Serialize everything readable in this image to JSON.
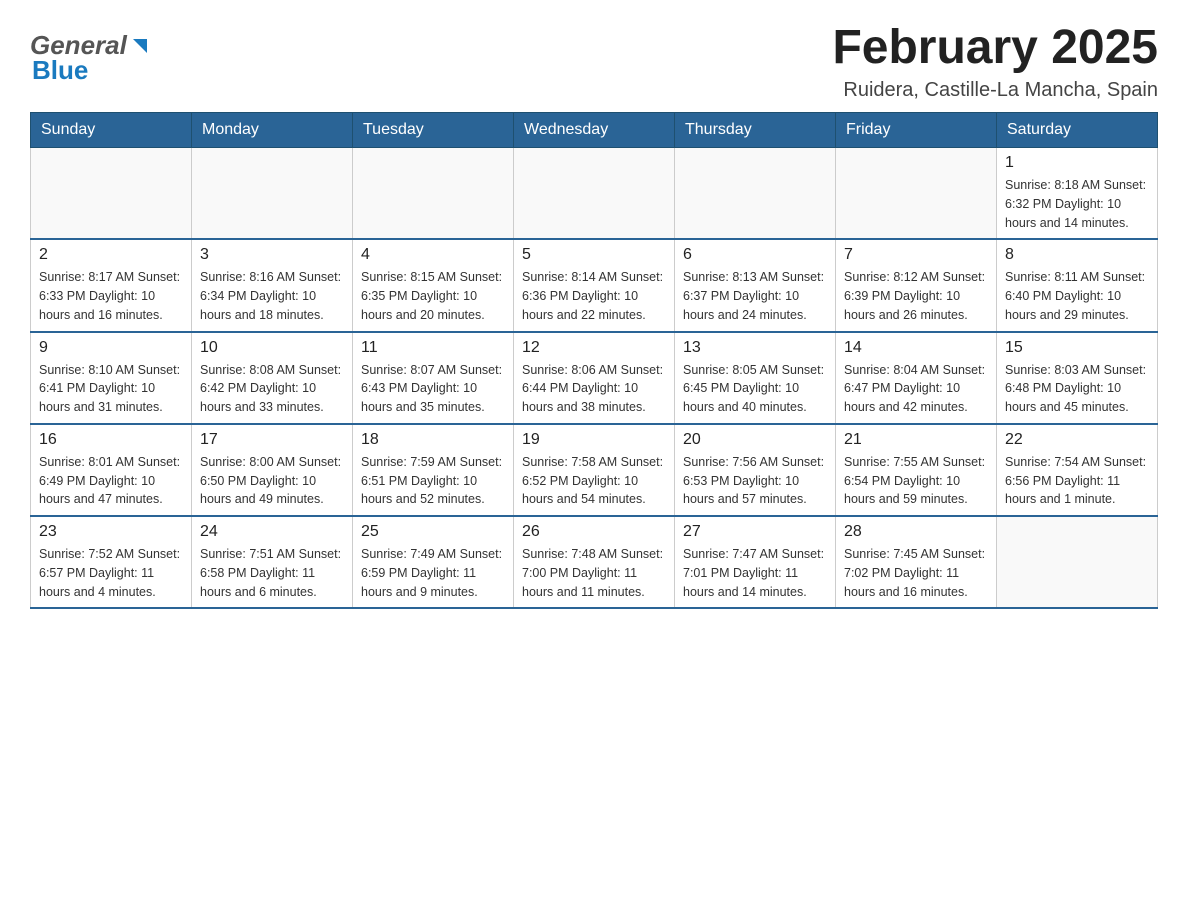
{
  "header": {
    "logo_general": "General",
    "logo_blue": "Blue",
    "title": "February 2025",
    "subtitle": "Ruidera, Castille-La Mancha, Spain"
  },
  "calendar": {
    "days_of_week": [
      "Sunday",
      "Monday",
      "Tuesday",
      "Wednesday",
      "Thursday",
      "Friday",
      "Saturday"
    ],
    "weeks": [
      [
        {
          "day": "",
          "info": ""
        },
        {
          "day": "",
          "info": ""
        },
        {
          "day": "",
          "info": ""
        },
        {
          "day": "",
          "info": ""
        },
        {
          "day": "",
          "info": ""
        },
        {
          "day": "",
          "info": ""
        },
        {
          "day": "1",
          "info": "Sunrise: 8:18 AM\nSunset: 6:32 PM\nDaylight: 10 hours and 14 minutes."
        }
      ],
      [
        {
          "day": "2",
          "info": "Sunrise: 8:17 AM\nSunset: 6:33 PM\nDaylight: 10 hours and 16 minutes."
        },
        {
          "day": "3",
          "info": "Sunrise: 8:16 AM\nSunset: 6:34 PM\nDaylight: 10 hours and 18 minutes."
        },
        {
          "day": "4",
          "info": "Sunrise: 8:15 AM\nSunset: 6:35 PM\nDaylight: 10 hours and 20 minutes."
        },
        {
          "day": "5",
          "info": "Sunrise: 8:14 AM\nSunset: 6:36 PM\nDaylight: 10 hours and 22 minutes."
        },
        {
          "day": "6",
          "info": "Sunrise: 8:13 AM\nSunset: 6:37 PM\nDaylight: 10 hours and 24 minutes."
        },
        {
          "day": "7",
          "info": "Sunrise: 8:12 AM\nSunset: 6:39 PM\nDaylight: 10 hours and 26 minutes."
        },
        {
          "day": "8",
          "info": "Sunrise: 8:11 AM\nSunset: 6:40 PM\nDaylight: 10 hours and 29 minutes."
        }
      ],
      [
        {
          "day": "9",
          "info": "Sunrise: 8:10 AM\nSunset: 6:41 PM\nDaylight: 10 hours and 31 minutes."
        },
        {
          "day": "10",
          "info": "Sunrise: 8:08 AM\nSunset: 6:42 PM\nDaylight: 10 hours and 33 minutes."
        },
        {
          "day": "11",
          "info": "Sunrise: 8:07 AM\nSunset: 6:43 PM\nDaylight: 10 hours and 35 minutes."
        },
        {
          "day": "12",
          "info": "Sunrise: 8:06 AM\nSunset: 6:44 PM\nDaylight: 10 hours and 38 minutes."
        },
        {
          "day": "13",
          "info": "Sunrise: 8:05 AM\nSunset: 6:45 PM\nDaylight: 10 hours and 40 minutes."
        },
        {
          "day": "14",
          "info": "Sunrise: 8:04 AM\nSunset: 6:47 PM\nDaylight: 10 hours and 42 minutes."
        },
        {
          "day": "15",
          "info": "Sunrise: 8:03 AM\nSunset: 6:48 PM\nDaylight: 10 hours and 45 minutes."
        }
      ],
      [
        {
          "day": "16",
          "info": "Sunrise: 8:01 AM\nSunset: 6:49 PM\nDaylight: 10 hours and 47 minutes."
        },
        {
          "day": "17",
          "info": "Sunrise: 8:00 AM\nSunset: 6:50 PM\nDaylight: 10 hours and 49 minutes."
        },
        {
          "day": "18",
          "info": "Sunrise: 7:59 AM\nSunset: 6:51 PM\nDaylight: 10 hours and 52 minutes."
        },
        {
          "day": "19",
          "info": "Sunrise: 7:58 AM\nSunset: 6:52 PM\nDaylight: 10 hours and 54 minutes."
        },
        {
          "day": "20",
          "info": "Sunrise: 7:56 AM\nSunset: 6:53 PM\nDaylight: 10 hours and 57 minutes."
        },
        {
          "day": "21",
          "info": "Sunrise: 7:55 AM\nSunset: 6:54 PM\nDaylight: 10 hours and 59 minutes."
        },
        {
          "day": "22",
          "info": "Sunrise: 7:54 AM\nSunset: 6:56 PM\nDaylight: 11 hours and 1 minute."
        }
      ],
      [
        {
          "day": "23",
          "info": "Sunrise: 7:52 AM\nSunset: 6:57 PM\nDaylight: 11 hours and 4 minutes."
        },
        {
          "day": "24",
          "info": "Sunrise: 7:51 AM\nSunset: 6:58 PM\nDaylight: 11 hours and 6 minutes."
        },
        {
          "day": "25",
          "info": "Sunrise: 7:49 AM\nSunset: 6:59 PM\nDaylight: 11 hours and 9 minutes."
        },
        {
          "day": "26",
          "info": "Sunrise: 7:48 AM\nSunset: 7:00 PM\nDaylight: 11 hours and 11 minutes."
        },
        {
          "day": "27",
          "info": "Sunrise: 7:47 AM\nSunset: 7:01 PM\nDaylight: 11 hours and 14 minutes."
        },
        {
          "day": "28",
          "info": "Sunrise: 7:45 AM\nSunset: 7:02 PM\nDaylight: 11 hours and 16 minutes."
        },
        {
          "day": "",
          "info": ""
        }
      ]
    ]
  }
}
